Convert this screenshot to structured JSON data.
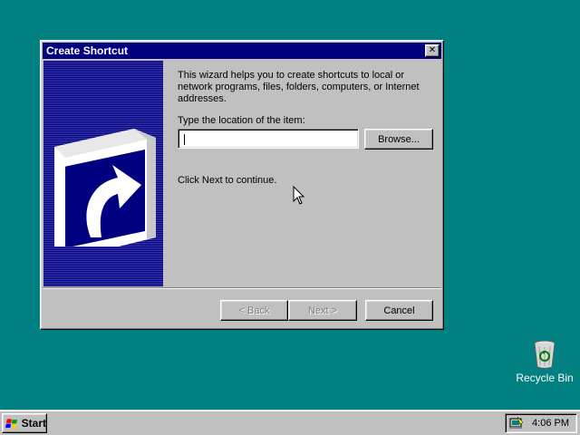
{
  "dialog": {
    "title": "Create Shortcut",
    "close_glyph": "✕",
    "intro_text": "This wizard helps you to create shortcuts to local or network programs, files, folders, computers, or Internet addresses.",
    "location_label": "Type the location of the item:",
    "location_value": "",
    "browse_label": "Browse...",
    "next_hint": "Click Next to continue.",
    "back_label": "< Back",
    "next_label": "Next >",
    "cancel_label": "Cancel",
    "back_enabled": false,
    "next_enabled": false,
    "side_icon": "shortcut-arrow-icon"
  },
  "desktop": {
    "icons": [
      {
        "label": "Recycle Bin",
        "icon": "recycle-bin-icon"
      }
    ]
  },
  "taskbar": {
    "start_label": "Start",
    "start_icon": "windows-logo-icon",
    "tray_icon": "scheduler-icon",
    "clock": "4:06 PM"
  },
  "colors": {
    "desktop": "#008080",
    "titlebar": "#000080",
    "face": "#c0c0c0"
  }
}
